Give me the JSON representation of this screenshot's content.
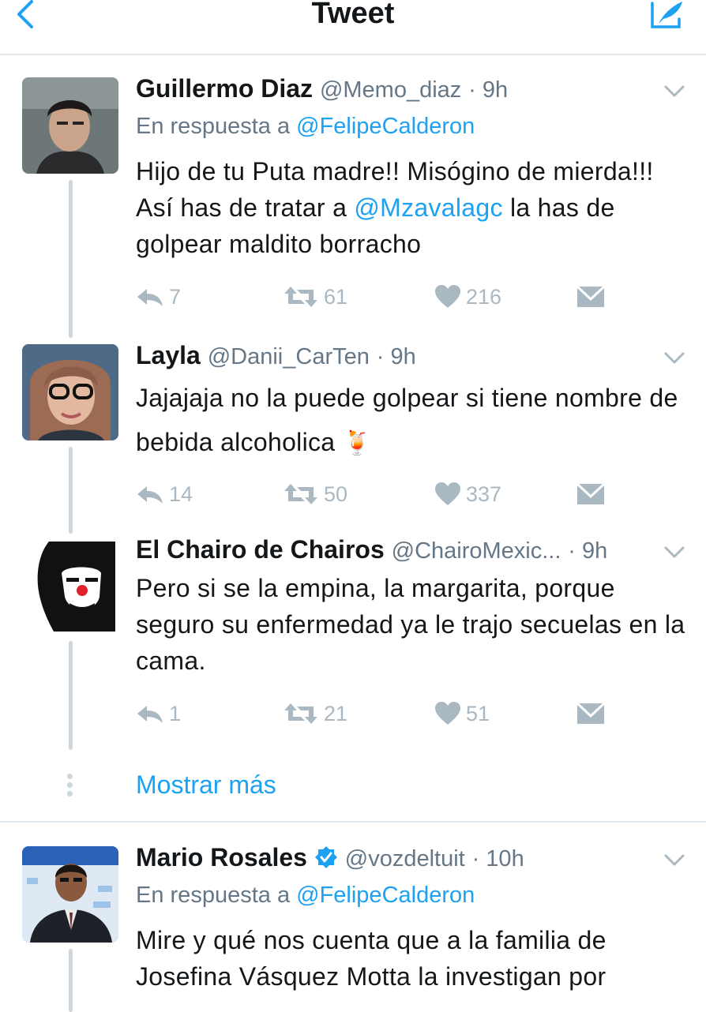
{
  "header": {
    "title": "Tweet"
  },
  "tweets": [
    {
      "name": "Guillermo Diaz",
      "handle": "@Memo_diaz",
      "time": "· 9h",
      "reply_prefix": "En respuesta a ",
      "reply_to": "@FelipeCalderon",
      "text_parts": [
        "Hijo de tu Puta madre!! Misógino de mierda!!! Así has de tratar a ",
        "@Mzavalagc",
        " la has de golpear maldito borracho"
      ],
      "replies": "7",
      "retweets": "61",
      "likes": "216"
    },
    {
      "name": "Layla",
      "handle": "@Danii_CarTen",
      "time": "· 9h",
      "text": "Jajajaja no la puede golpear si tiene nombre de bebida alcoholica",
      "emoji": "🍹",
      "replies": "14",
      "retweets": "50",
      "likes": "337"
    },
    {
      "name": "El Chairo de Chairos",
      "handle": "@ChairoMexic...",
      "time": "· 9h",
      "text": "Pero si se la empina, la margarita, porque seguro su enfermedad ya le trajo secuelas en la cama.",
      "replies": "1",
      "retweets": "21",
      "likes": "51"
    },
    {
      "name": "Mario Rosales",
      "handle": "@vozdeltuit",
      "time": "· 10h",
      "reply_prefix": "En respuesta a ",
      "reply_to": "@FelipeCalderon",
      "text": "Mire y qué nos cuenta que a la familia de Josefina Vásquez Motta la investigan por"
    }
  ],
  "show_more": "Mostrar más",
  "colors": {
    "link": "#1da1f2",
    "secondary": "#657786",
    "icon": "#aab8c2",
    "verified": "#1da1f2"
  }
}
